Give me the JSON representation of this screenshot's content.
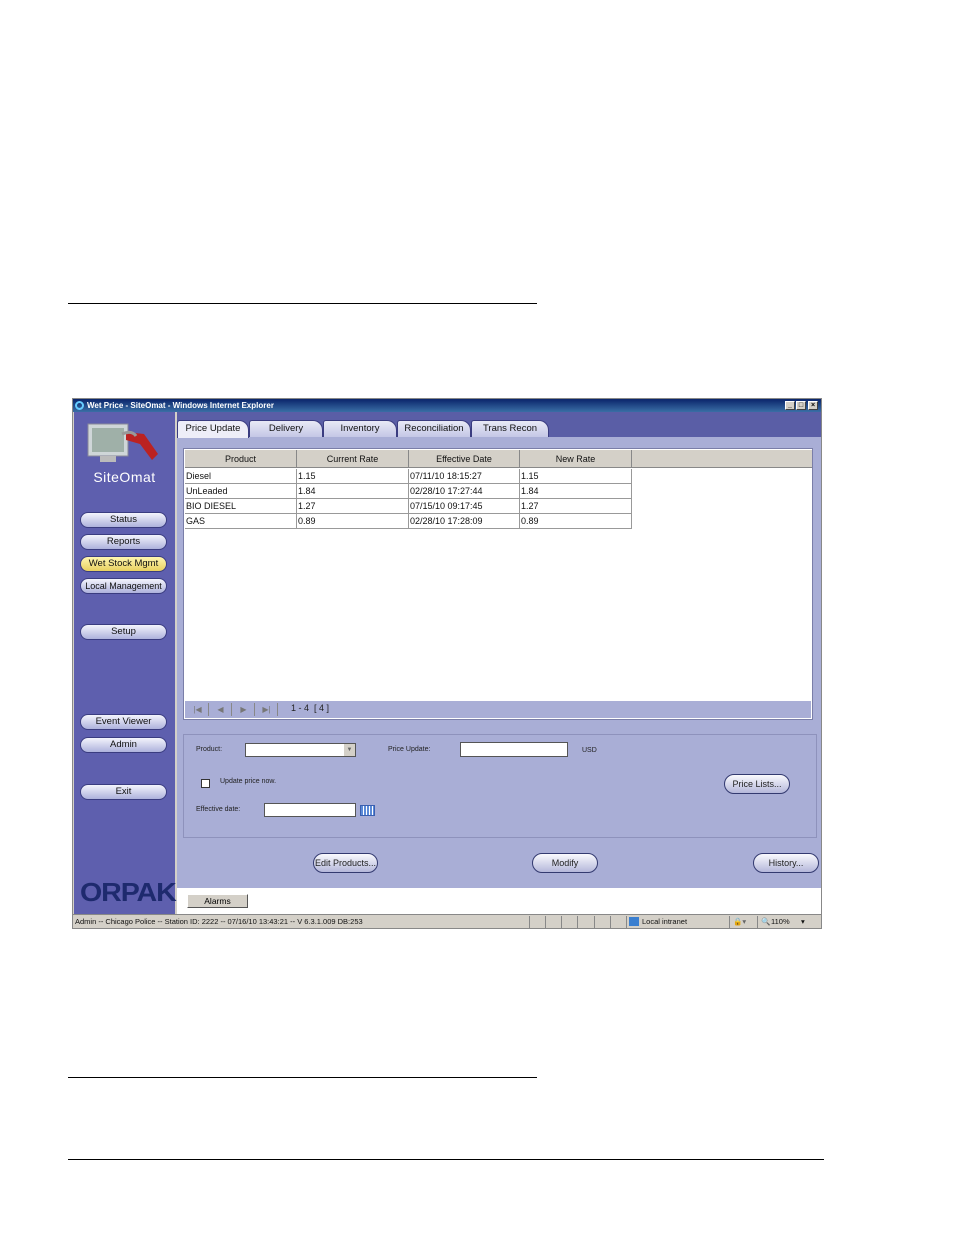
{
  "window": {
    "title": "Wet Price - SiteOmat - Windows Internet Explorer",
    "controls": [
      "_",
      "□",
      "×"
    ]
  },
  "sidebar": {
    "brand": "SiteOmat",
    "logo": "ORPAK",
    "items": [
      {
        "label": "Status",
        "active": false
      },
      {
        "label": "Reports",
        "active": false
      },
      {
        "label": "Wet Stock Mgmt",
        "active": true
      },
      {
        "label": "Local Management",
        "active": false
      },
      {
        "label": "Setup",
        "active": false
      },
      {
        "label": "Event Viewer",
        "active": false
      },
      {
        "label": "Admin",
        "active": false
      },
      {
        "label": "Exit",
        "active": false
      }
    ]
  },
  "tabs": [
    {
      "label": "Price Update",
      "selected": true
    },
    {
      "label": "Delivery"
    },
    {
      "label": "Inventory"
    },
    {
      "label": "Reconciliation"
    },
    {
      "label": "Trans Recon"
    }
  ],
  "table": {
    "columns": [
      "Product",
      "Current Rate",
      "Effective Date",
      "New Rate"
    ],
    "rows": [
      [
        "Diesel",
        "1.15",
        "07/11/10 18:15:27",
        "1.15"
      ],
      [
        "UnLeaded",
        "1.84",
        "02/28/10 17:27:44",
        "1.84"
      ],
      [
        "BIO DIESEL",
        "1.27",
        "07/15/10 09:17:45",
        "1.27"
      ],
      [
        "GAS",
        "0.89",
        "02/28/10 17:28:09",
        "0.89"
      ]
    ],
    "pager": {
      "range": "1 - 4  [ 4 ]",
      "icons": [
        "first-icon",
        "prev-icon",
        "next-icon",
        "last-icon"
      ]
    }
  },
  "form": {
    "product_label": "Product:",
    "product_value": "",
    "price_label": "Price Update:",
    "price_value": "",
    "currency": "USD",
    "update_now_label": "Update price now.",
    "update_now_checked": false,
    "date_label": "Effective date:",
    "date_value": "",
    "price_lists": "Price Lists..."
  },
  "actions": {
    "edit_products": "Edit Products...",
    "modify": "Modify",
    "history": "History..."
  },
  "alarms": "Alarms",
  "statusbar": {
    "text": "Admin -- Chicago Police -- Station ID: 2222 -- 07/16/10 13:43:21 -- V 6.3.1.009 DB:253",
    "zone": "Local intranet",
    "zoom": "110%"
  },
  "colors": {
    "sidebar": "#5e5fae",
    "main": "#a9aed6",
    "active_button": "#f0dc80"
  }
}
